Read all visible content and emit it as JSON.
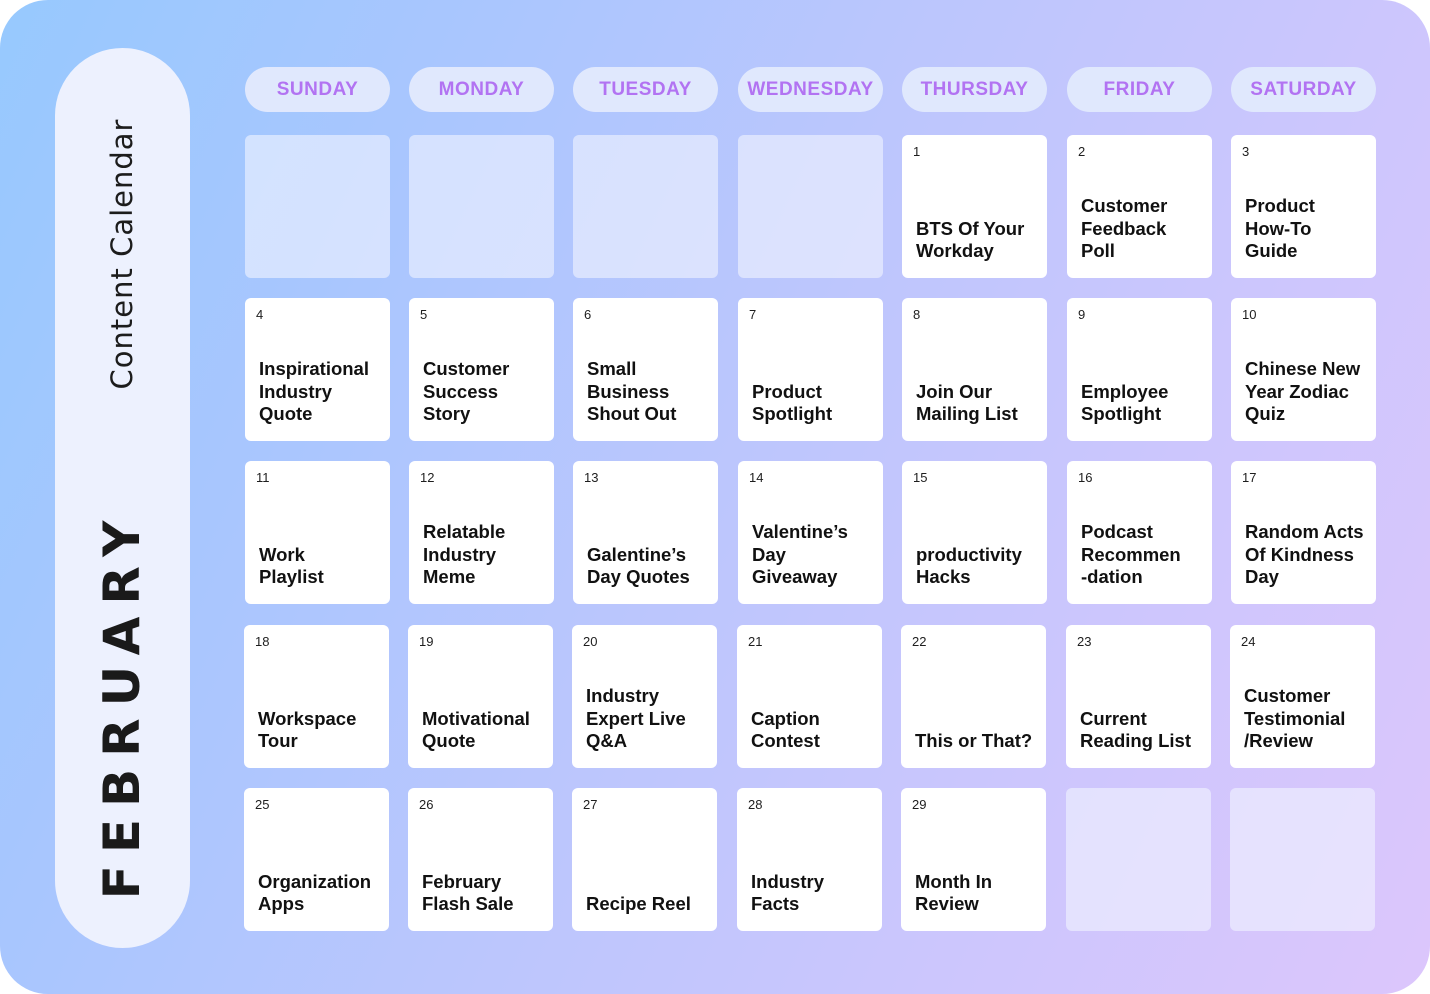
{
  "sidebar": {
    "subtitle": "Content Calendar",
    "month": "FEBRUARY"
  },
  "colors": {
    "accent_day_label": "#b273f2",
    "header_pill_bg": "#e0e8fd",
    "cell_bg": "#ffffff",
    "gradient_start": "#97c9fe",
    "gradient_end": "#dcc6fc"
  },
  "weekdays": [
    "SUNDAY",
    "MONDAY",
    "TUESDAY",
    "WEDNESDAY",
    "THURSDAY",
    "FRIDAY",
    "SATURDAY"
  ],
  "weeks": [
    [
      {
        "day": "",
        "topic": ""
      },
      {
        "day": "",
        "topic": ""
      },
      {
        "day": "",
        "topic": ""
      },
      {
        "day": "",
        "topic": ""
      },
      {
        "day": "1",
        "topic": "BTS Of Your\nWorkday"
      },
      {
        "day": "2",
        "topic": "Customer\nFeedback\nPoll"
      },
      {
        "day": "3",
        "topic": "Product\nHow-To\nGuide"
      }
    ],
    [
      {
        "day": "4",
        "topic": "Inspirational\nIndustry\nQuote"
      },
      {
        "day": "5",
        "topic": "Customer\nSuccess\nStory"
      },
      {
        "day": "6",
        "topic": "Small\nBusiness\nShout Out"
      },
      {
        "day": "7",
        "topic": "Product\nSpotlight"
      },
      {
        "day": "8",
        "topic": "Join Our\nMailing List"
      },
      {
        "day": "9",
        "topic": "Employee\nSpotlight"
      },
      {
        "day": "10",
        "topic": "Chinese New\nYear Zodiac\nQuiz"
      }
    ],
    [
      {
        "day": "11",
        "topic": "Work\nPlaylist"
      },
      {
        "day": "12",
        "topic": "Relatable\nIndustry\nMeme"
      },
      {
        "day": "13",
        "topic": "Galentine’s\nDay Quotes"
      },
      {
        "day": "14",
        "topic": "Valentine’s\nDay\nGiveaway"
      },
      {
        "day": "15",
        "topic": "productivity\nHacks"
      },
      {
        "day": "16",
        "topic": "Podcast\nRecommen\n-dation"
      },
      {
        "day": "17",
        "topic": "Random Acts\nOf Kindness\nDay"
      }
    ],
    [
      {
        "day": "18",
        "topic": "Workspace\nTour"
      },
      {
        "day": "19",
        "topic": "Motivational\nQuote"
      },
      {
        "day": "20",
        "topic": "Industry\nExpert Live\nQ&A"
      },
      {
        "day": "21",
        "topic": "Caption\nContest"
      },
      {
        "day": "22",
        "topic": "This or That?"
      },
      {
        "day": "23",
        "topic": "Current\nReading List"
      },
      {
        "day": "24",
        "topic": "Customer\nTestimonial\n/Review"
      }
    ],
    [
      {
        "day": "25",
        "topic": "Organization\nApps"
      },
      {
        "day": "26",
        "topic": "February\nFlash Sale"
      },
      {
        "day": "27",
        "topic": "Recipe Reel"
      },
      {
        "day": "28",
        "topic": "Industry\nFacts"
      },
      {
        "day": "29",
        "topic": "Month In\nReview"
      },
      {
        "day": "",
        "topic": ""
      },
      {
        "day": "",
        "topic": ""
      }
    ]
  ]
}
